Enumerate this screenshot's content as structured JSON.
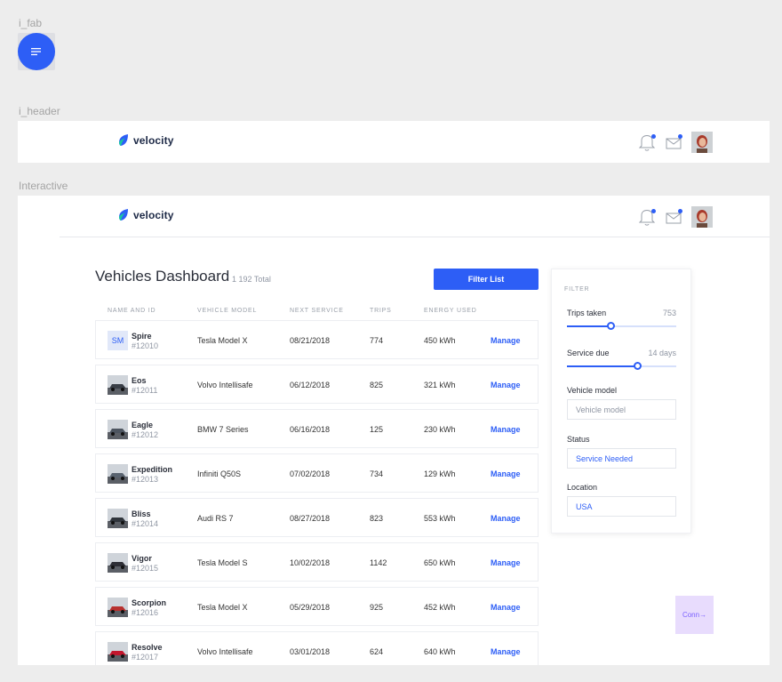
{
  "frames": {
    "fab_label": "i_fab",
    "header_label": "i_header",
    "interactive_label": "Interactive"
  },
  "brand": {
    "name": "velocity",
    "accent": "#2d5ef6"
  },
  "dashboard": {
    "title": "Vehicles Dashboard",
    "total": "1 192 Total",
    "filter_button": "Filter List",
    "columns": [
      "Name and ID",
      "Vehicle Model",
      "Next Service",
      "Trips",
      "Energy Used"
    ],
    "manage_label": "Manage",
    "rows": [
      {
        "initials": "SM",
        "name": "Spire",
        "id": "#12010",
        "model": "Tesla Model X",
        "service": "08/21/2018",
        "trips": "774",
        "energy": "450 kWh"
      },
      {
        "name": "Eos",
        "id": "#12011",
        "model": "Volvo Intellisafe",
        "service": "06/12/2018",
        "trips": "825",
        "energy": "321 kWh"
      },
      {
        "name": "Eagle",
        "id": "#12012",
        "model": "BMW 7 Series",
        "service": "06/16/2018",
        "trips": "125",
        "energy": "230 kWh"
      },
      {
        "name": "Expedition",
        "id": "#12013",
        "model": "Infiniti Q50S",
        "service": "07/02/2018",
        "trips": "734",
        "energy": "129 kWh"
      },
      {
        "name": "Bliss",
        "id": "#12014",
        "model": "Audi RS 7",
        "service": "08/27/2018",
        "trips": "823",
        "energy": "553 kWh"
      },
      {
        "name": "Vigor",
        "id": "#12015",
        "model": "Tesla Model S",
        "service": "10/02/2018",
        "trips": "1142",
        "energy": "650 kWh"
      },
      {
        "name": "Scorpion",
        "id": "#12016",
        "model": "Tesla Model X",
        "service": "05/29/2018",
        "trips": "925",
        "energy": "452 kWh"
      },
      {
        "name": "Resolve",
        "id": "#12017",
        "model": "Volvo Intellisafe",
        "service": "03/01/2018",
        "trips": "624",
        "energy": "640 kWh"
      }
    ],
    "thumb_colors": [
      "#3a3f47",
      "#4d5560",
      "#5a6470",
      "#30353c",
      "#2e2f36",
      "#b8312f",
      "#c2162d"
    ]
  },
  "filter": {
    "title": "FILTER",
    "trips": {
      "label": "Trips taken",
      "value": "753",
      "fraction": 0.4
    },
    "service": {
      "label": "Service due",
      "value": "14 days",
      "fraction": 0.64
    },
    "model": {
      "label": "Vehicle model",
      "placeholder": "Vehicle model"
    },
    "status": {
      "label": "Status",
      "value": "Service Needed"
    },
    "location": {
      "label": "Location",
      "value": "USA"
    }
  },
  "connector": {
    "label": "Conn→"
  }
}
